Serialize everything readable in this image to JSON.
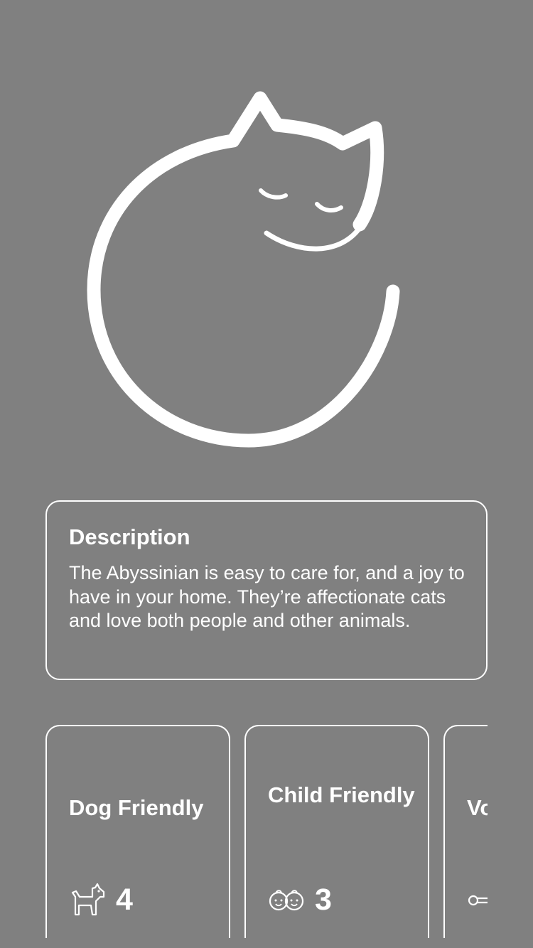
{
  "hero": {
    "icon": "sleeping-cat-illustration"
  },
  "description": {
    "title": "Description",
    "body": "The Abyssinian is easy to care for, and a joy to have in your home. They’re affectionate cats and love both people and other animals."
  },
  "traits": [
    {
      "label": "Dog Friendly",
      "icon": "dog-icon",
      "value": "4"
    },
    {
      "label": "Child Friendly",
      "icon": "child-faces-icon",
      "value": "3"
    },
    {
      "label": "Vo",
      "icon": "whistle-icon",
      "value": ""
    }
  ],
  "colors": {
    "background": "#808080",
    "foreground": "#ffffff"
  }
}
